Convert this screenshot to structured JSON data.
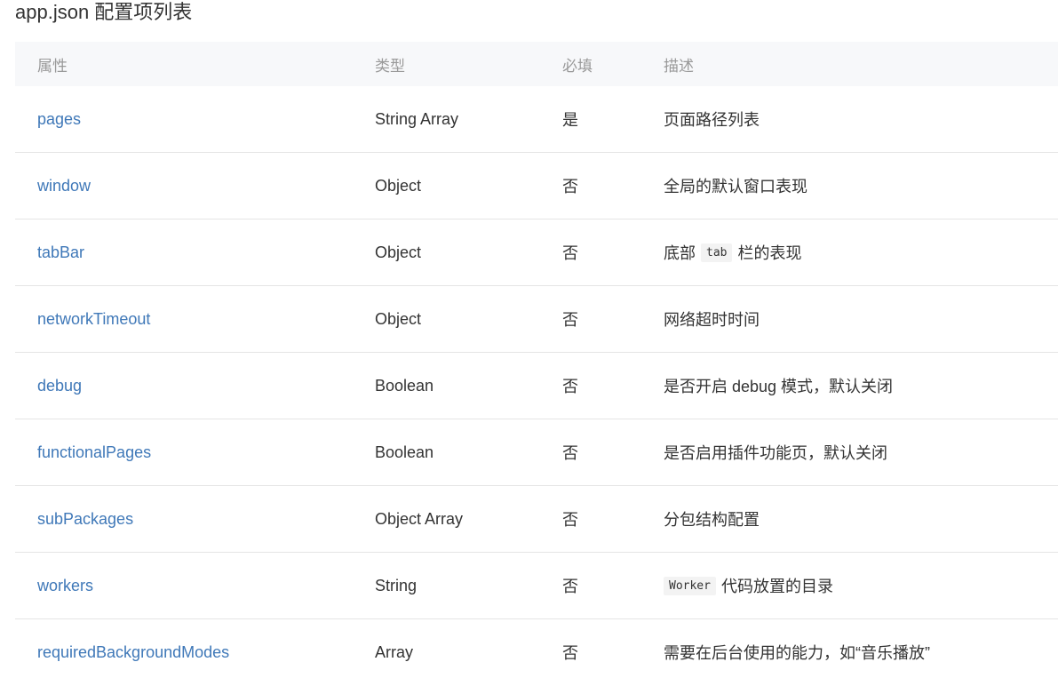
{
  "page": {
    "title": "app.json 配置项列表"
  },
  "table": {
    "headers": {
      "property": "属性",
      "type": "类型",
      "required": "必填",
      "description": "描述"
    },
    "rows": [
      {
        "property": "pages",
        "type": "String Array",
        "required": "是",
        "description": "页面路径列表"
      },
      {
        "property": "window",
        "type": "Object",
        "required": "否",
        "description": "全局的默认窗口表现"
      },
      {
        "property": "tabBar",
        "type": "Object",
        "required": "否",
        "desc_before": "底部",
        "desc_code": "tab",
        "desc_after": "栏的表现"
      },
      {
        "property": "networkTimeout",
        "type": "Object",
        "required": "否",
        "description": "网络超时时间"
      },
      {
        "property": "debug",
        "type": "Boolean",
        "required": "否",
        "description": "是否开启 debug 模式，默认关闭"
      },
      {
        "property": "functionalPages",
        "type": "Boolean",
        "required": "否",
        "description": "是否启用插件功能页，默认关闭"
      },
      {
        "property": "subPackages",
        "type": "Object Array",
        "required": "否",
        "description": "分包结构配置"
      },
      {
        "property": "workers",
        "type": "String",
        "required": "否",
        "desc_code": "Worker",
        "desc_after": "代码放置的目录"
      },
      {
        "property": "requiredBackgroundModes",
        "type": "Array",
        "required": "否",
        "description": "需要在后台使用的能力，如“音乐播放”"
      }
    ]
  },
  "colors": {
    "link": "#3f78b8",
    "header_bg": "#f7f8fa",
    "header_text": "#999999",
    "border": "#e5e5e5",
    "code_bg": "#f3f3f3"
  }
}
